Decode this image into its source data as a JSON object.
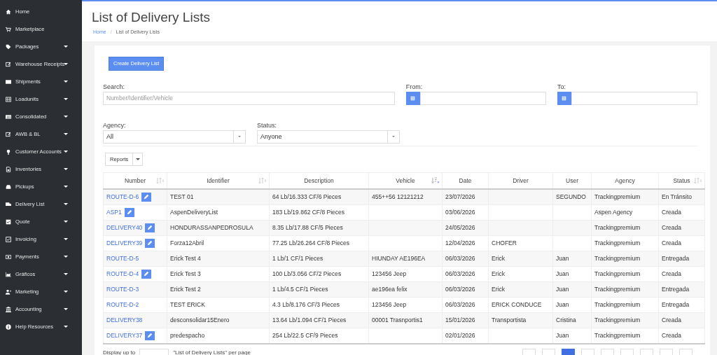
{
  "sidebar": {
    "items": [
      {
        "label": "Home",
        "expandable": false
      },
      {
        "label": "Marketplace",
        "expandable": false
      },
      {
        "label": "Packages",
        "expandable": true
      },
      {
        "label": "Warehouse Receipts",
        "expandable": true
      },
      {
        "label": "Shipments",
        "expandable": true
      },
      {
        "label": "Loadunits",
        "expandable": true
      },
      {
        "label": "Consolidated",
        "expandable": true
      },
      {
        "label": "AWB & BL",
        "expandable": true
      },
      {
        "label": "Customer Accounts",
        "expandable": true
      },
      {
        "label": "Inventories",
        "expandable": true
      },
      {
        "label": "Pickups",
        "expandable": true
      },
      {
        "label": "Delivery List",
        "expandable": true
      },
      {
        "label": "Quote",
        "expandable": true
      },
      {
        "label": "Invoicing",
        "expandable": true
      },
      {
        "label": "Payments",
        "expandable": true
      },
      {
        "label": "Gráficos",
        "expandable": true
      },
      {
        "label": "Marketing",
        "expandable": true
      },
      {
        "label": "Accounting",
        "expandable": true
      },
      {
        "label": "Help Resources",
        "expandable": true
      }
    ]
  },
  "page": {
    "title": "List of Delivery Lists",
    "breadcrumb": [
      {
        "label": "Home",
        "link": true
      },
      {
        "label": "List of Delivery Lists",
        "link": false
      }
    ],
    "breadcrumb_separator": "/"
  },
  "create_button": "Create Delivery List",
  "filters": {
    "search": {
      "label": "Search:",
      "placeholder": "Number/Identifier/Vehicle"
    },
    "from": {
      "label": "From:"
    },
    "to": {
      "label": "To:"
    },
    "agency": {
      "label": "Agency:",
      "value": "All"
    },
    "status": {
      "label": "Status:",
      "value": "Anyone"
    }
  },
  "reports_button": "Reports",
  "table": {
    "columns": [
      {
        "label": "Number",
        "sortable": true,
        "sorted_desc": false
      },
      {
        "label": "Identifier",
        "sortable": true,
        "sorted_desc": false
      },
      {
        "label": "Description",
        "sortable": false
      },
      {
        "label": "Vehicle",
        "sortable": true,
        "sorted_desc": true
      },
      {
        "label": "Date",
        "sortable": false
      },
      {
        "label": "Driver",
        "sortable": false
      },
      {
        "label": "User",
        "sortable": false
      },
      {
        "label": "Agency",
        "sortable": false
      },
      {
        "label": "Status",
        "sortable": true,
        "sorted_desc": false
      }
    ],
    "rows": [
      {
        "editable": true,
        "cells": [
          "ROUTE-D-6",
          "TEST 01",
          "64 Lb/16.333 CF/6 Pieces",
          "455++56 12121212",
          "23/07/2026",
          "",
          "SEGUNDO",
          "Trackingpremium",
          "En Tránsito"
        ]
      },
      {
        "editable": true,
        "cells": [
          "ASP1",
          "AspenDeliveryList",
          "183 Lb/19.862 CF/8 Pieces",
          "",
          "03/06/2026",
          "",
          "",
          "Aspen Agency",
          "Creada"
        ]
      },
      {
        "editable": true,
        "cells": [
          "DELIVERY40",
          "HONDURASSANPEDROSULA",
          "8.35 Lb/17.88 CF/5 Pieces",
          "",
          "24/05/2026",
          "",
          "",
          "Trackingpremium",
          "Creada"
        ]
      },
      {
        "editable": true,
        "cells": [
          "DELIVERY39",
          "Forza12Abril",
          "77.25 Lb/26.264 CF/8 Pieces",
          "",
          "12/04/2026",
          "CHOFER",
          "",
          "Trackingpremium",
          "Creada"
        ]
      },
      {
        "editable": false,
        "cells": [
          "ROUTE-D-5",
          "Erick Test 4",
          "1 Lb/1 CF/1 Pieces",
          "HIUNDAY AE196EA",
          "06/03/2026",
          "Erick",
          "Juan",
          "Trackingpremium",
          "Entregada"
        ]
      },
      {
        "editable": true,
        "cells": [
          "ROUTE-D-4",
          "Erick Test 3",
          "100 Lb/3.056 CF/2 Pieces",
          "123456 Jeep",
          "06/03/2026",
          "Erick",
          "Juan",
          "Trackingpremium",
          "Creada"
        ]
      },
      {
        "editable": false,
        "cells": [
          "ROUTE-D-3",
          "Erick Test 2",
          "1 Lb/4.5 CF/1 Pieces",
          "ae196ea felix",
          "06/03/2026",
          "Erick",
          "Juan",
          "Trackingpremium",
          "Entregada"
        ]
      },
      {
        "editable": false,
        "cells": [
          "ROUTE-D-2",
          "TEST ERICK",
          "4.3 Lb/8.176 CF/3 Pieces",
          "123456 Jeep",
          "06/03/2026",
          "ERICK CONDUCE",
          "Juan",
          "Trackingpremium",
          "Entregada"
        ]
      },
      {
        "editable": false,
        "cells": [
          "DELIVERY38",
          "desconsolidar15Enero",
          "13.64 Lb/1.094 CF/1 Pieces",
          "00001 Trasnportis1",
          "15/01/2026",
          "Transportista",
          "Cristina",
          "Trackingpremium",
          "Creada"
        ]
      },
      {
        "editable": true,
        "cells": [
          "DELIVERY37",
          "predespacho",
          "254 Lb/22.5 CF/9 Pieces",
          "",
          "02/01/2026",
          "",
          "Juan",
          "Trackingpremium",
          "Creada"
        ]
      }
    ]
  },
  "footer": {
    "prefix": "Display up to",
    "suffix": "\"List of Delivery Lists\" per page",
    "pages": [
      {
        "selected": false
      },
      {
        "selected": false
      },
      {
        "selected": true
      },
      {
        "selected": false
      },
      {
        "selected": false
      },
      {
        "selected": false
      },
      {
        "selected": false
      },
      {
        "selected": false
      },
      {
        "selected": false
      }
    ]
  }
}
